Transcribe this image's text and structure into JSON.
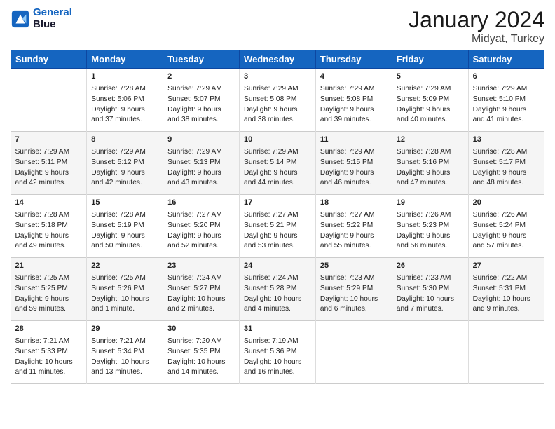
{
  "logo": {
    "line1": "General",
    "line2": "Blue"
  },
  "title": "January 2024",
  "subtitle": "Midyat, Turkey",
  "header_days": [
    "Sunday",
    "Monday",
    "Tuesday",
    "Wednesday",
    "Thursday",
    "Friday",
    "Saturday"
  ],
  "weeks": [
    [
      {
        "day": "",
        "text": ""
      },
      {
        "day": "1",
        "text": "Sunrise: 7:28 AM\nSunset: 5:06 PM\nDaylight: 9 hours\nand 37 minutes."
      },
      {
        "day": "2",
        "text": "Sunrise: 7:29 AM\nSunset: 5:07 PM\nDaylight: 9 hours\nand 38 minutes."
      },
      {
        "day": "3",
        "text": "Sunrise: 7:29 AM\nSunset: 5:08 PM\nDaylight: 9 hours\nand 38 minutes."
      },
      {
        "day": "4",
        "text": "Sunrise: 7:29 AM\nSunset: 5:08 PM\nDaylight: 9 hours\nand 39 minutes."
      },
      {
        "day": "5",
        "text": "Sunrise: 7:29 AM\nSunset: 5:09 PM\nDaylight: 9 hours\nand 40 minutes."
      },
      {
        "day": "6",
        "text": "Sunrise: 7:29 AM\nSunset: 5:10 PM\nDaylight: 9 hours\nand 41 minutes."
      }
    ],
    [
      {
        "day": "7",
        "text": "Sunrise: 7:29 AM\nSunset: 5:11 PM\nDaylight: 9 hours\nand 42 minutes."
      },
      {
        "day": "8",
        "text": "Sunrise: 7:29 AM\nSunset: 5:12 PM\nDaylight: 9 hours\nand 42 minutes."
      },
      {
        "day": "9",
        "text": "Sunrise: 7:29 AM\nSunset: 5:13 PM\nDaylight: 9 hours\nand 43 minutes."
      },
      {
        "day": "10",
        "text": "Sunrise: 7:29 AM\nSunset: 5:14 PM\nDaylight: 9 hours\nand 44 minutes."
      },
      {
        "day": "11",
        "text": "Sunrise: 7:29 AM\nSunset: 5:15 PM\nDaylight: 9 hours\nand 46 minutes."
      },
      {
        "day": "12",
        "text": "Sunrise: 7:28 AM\nSunset: 5:16 PM\nDaylight: 9 hours\nand 47 minutes."
      },
      {
        "day": "13",
        "text": "Sunrise: 7:28 AM\nSunset: 5:17 PM\nDaylight: 9 hours\nand 48 minutes."
      }
    ],
    [
      {
        "day": "14",
        "text": "Sunrise: 7:28 AM\nSunset: 5:18 PM\nDaylight: 9 hours\nand 49 minutes."
      },
      {
        "day": "15",
        "text": "Sunrise: 7:28 AM\nSunset: 5:19 PM\nDaylight: 9 hours\nand 50 minutes."
      },
      {
        "day": "16",
        "text": "Sunrise: 7:27 AM\nSunset: 5:20 PM\nDaylight: 9 hours\nand 52 minutes."
      },
      {
        "day": "17",
        "text": "Sunrise: 7:27 AM\nSunset: 5:21 PM\nDaylight: 9 hours\nand 53 minutes."
      },
      {
        "day": "18",
        "text": "Sunrise: 7:27 AM\nSunset: 5:22 PM\nDaylight: 9 hours\nand 55 minutes."
      },
      {
        "day": "19",
        "text": "Sunrise: 7:26 AM\nSunset: 5:23 PM\nDaylight: 9 hours\nand 56 minutes."
      },
      {
        "day": "20",
        "text": "Sunrise: 7:26 AM\nSunset: 5:24 PM\nDaylight: 9 hours\nand 57 minutes."
      }
    ],
    [
      {
        "day": "21",
        "text": "Sunrise: 7:25 AM\nSunset: 5:25 PM\nDaylight: 9 hours\nand 59 minutes."
      },
      {
        "day": "22",
        "text": "Sunrise: 7:25 AM\nSunset: 5:26 PM\nDaylight: 10 hours\nand 1 minute."
      },
      {
        "day": "23",
        "text": "Sunrise: 7:24 AM\nSunset: 5:27 PM\nDaylight: 10 hours\nand 2 minutes."
      },
      {
        "day": "24",
        "text": "Sunrise: 7:24 AM\nSunset: 5:28 PM\nDaylight: 10 hours\nand 4 minutes."
      },
      {
        "day": "25",
        "text": "Sunrise: 7:23 AM\nSunset: 5:29 PM\nDaylight: 10 hours\nand 6 minutes."
      },
      {
        "day": "26",
        "text": "Sunrise: 7:23 AM\nSunset: 5:30 PM\nDaylight: 10 hours\nand 7 minutes."
      },
      {
        "day": "27",
        "text": "Sunrise: 7:22 AM\nSunset: 5:31 PM\nDaylight: 10 hours\nand 9 minutes."
      }
    ],
    [
      {
        "day": "28",
        "text": "Sunrise: 7:21 AM\nSunset: 5:33 PM\nDaylight: 10 hours\nand 11 minutes."
      },
      {
        "day": "29",
        "text": "Sunrise: 7:21 AM\nSunset: 5:34 PM\nDaylight: 10 hours\nand 13 minutes."
      },
      {
        "day": "30",
        "text": "Sunrise: 7:20 AM\nSunset: 5:35 PM\nDaylight: 10 hours\nand 14 minutes."
      },
      {
        "day": "31",
        "text": "Sunrise: 7:19 AM\nSunset: 5:36 PM\nDaylight: 10 hours\nand 16 minutes."
      },
      {
        "day": "",
        "text": ""
      },
      {
        "day": "",
        "text": ""
      },
      {
        "day": "",
        "text": ""
      }
    ]
  ]
}
